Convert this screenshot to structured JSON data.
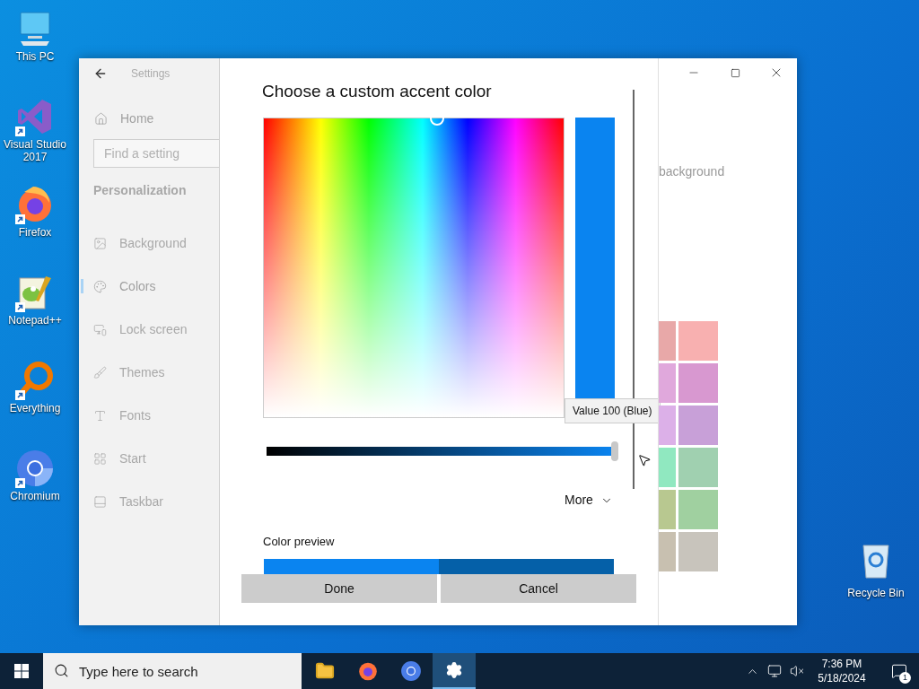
{
  "desktop_icons": [
    {
      "label": "This PC",
      "kind": "pc"
    },
    {
      "label": "Visual Studio 2017",
      "kind": "vs"
    },
    {
      "label": "Firefox",
      "kind": "firefox"
    },
    {
      "label": "Notepad++",
      "kind": "notepad"
    },
    {
      "label": "Everything",
      "kind": "everything"
    },
    {
      "label": "Chromium",
      "kind": "chromium"
    }
  ],
  "recycle_bin": {
    "label": "Recycle Bin"
  },
  "settings_window": {
    "title": "Settings",
    "sidebar": {
      "home": "Home",
      "search": {
        "placeholder": "Find a setting"
      },
      "section": "Personalization",
      "items": [
        {
          "label": "Background",
          "kind": "picture",
          "selected": false
        },
        {
          "label": "Colors",
          "kind": "palette",
          "selected": true
        },
        {
          "label": "Lock screen",
          "kind": "lock",
          "selected": false
        },
        {
          "label": "Themes",
          "kind": "brush",
          "selected": false
        },
        {
          "label": "Fonts",
          "kind": "fonts",
          "selected": false
        },
        {
          "label": "Start",
          "kind": "start",
          "selected": false
        },
        {
          "label": "Taskbar",
          "kind": "taskbar",
          "selected": false
        }
      ]
    },
    "background_text": "background",
    "swatches": [
      {
        "color": "#e8a8a8"
      },
      {
        "color": "#f8b0b0"
      },
      {
        "color": "#e0a8dc"
      },
      {
        "color": "#d898d0"
      },
      {
        "color": "#dcb0e8"
      },
      {
        "color": "#c8a0d8"
      },
      {
        "color": "#90e8c0"
      },
      {
        "color": "#a0d0b0"
      },
      {
        "color": "#b8c890"
      },
      {
        "color": "#a0d0a0"
      },
      {
        "color": "#c8c0b0"
      },
      {
        "color": "#c8c4bc"
      }
    ]
  },
  "dialog": {
    "title": "Choose a custom accent color",
    "value_slider": {
      "level": 1,
      "tooltip": "Value 100 (Blue)"
    },
    "more": "More",
    "preview_label": "Color preview",
    "buttons": [
      "Done",
      "Cancel"
    ]
  },
  "taskbar": {
    "search": {
      "placeholder": "Type here to search"
    },
    "apps": [
      {
        "kind": "explorer",
        "selected": false
      },
      {
        "kind": "firefox",
        "selected": false
      },
      {
        "kind": "chromium",
        "selected": false
      },
      {
        "kind": "settings",
        "selected": true
      }
    ],
    "time": "7:36 PM",
    "date": "5/18/2024",
    "notifications": "1"
  }
}
